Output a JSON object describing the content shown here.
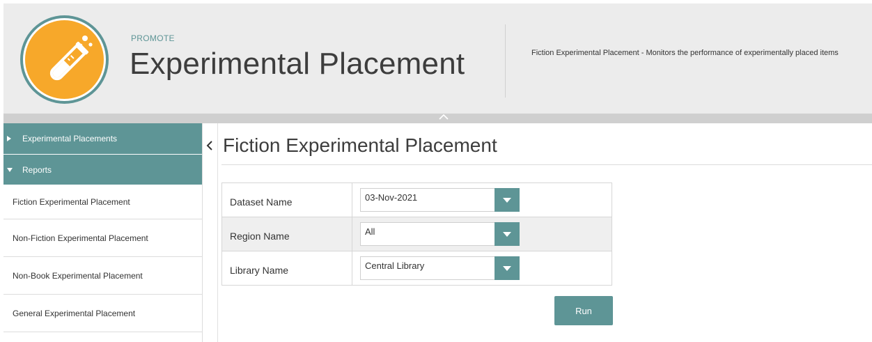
{
  "header": {
    "section_label": "PROMOTE",
    "title": "Experimental Placement",
    "description": "Fiction Experimental Placement - Monitors the performance of experimentally placed items",
    "logo_icon": "test-tube-icon"
  },
  "sidebar": {
    "groups": [
      {
        "label": "Experimental Placements",
        "state": "collapsed"
      },
      {
        "label": "Reports",
        "state": "expanded"
      }
    ],
    "items": [
      {
        "label": "Fiction Experimental Placement"
      },
      {
        "label": "Non-Fiction Experimental Placement"
      },
      {
        "label": "Non-Book Experimental Placement"
      },
      {
        "label": "General Experimental Placement"
      }
    ]
  },
  "main": {
    "title": "Fiction Experimental Placement",
    "form": {
      "rows": [
        {
          "label": "Dataset Name",
          "value": "03-Nov-2021"
        },
        {
          "label": "Region Name",
          "value": "All"
        },
        {
          "label": "Library Name",
          "value": "Central Library"
        }
      ]
    },
    "run_label": "Run"
  },
  "colors": {
    "accent": "#5e9596",
    "logo_orange": "#f7a82a",
    "header_bg": "#ececec"
  }
}
